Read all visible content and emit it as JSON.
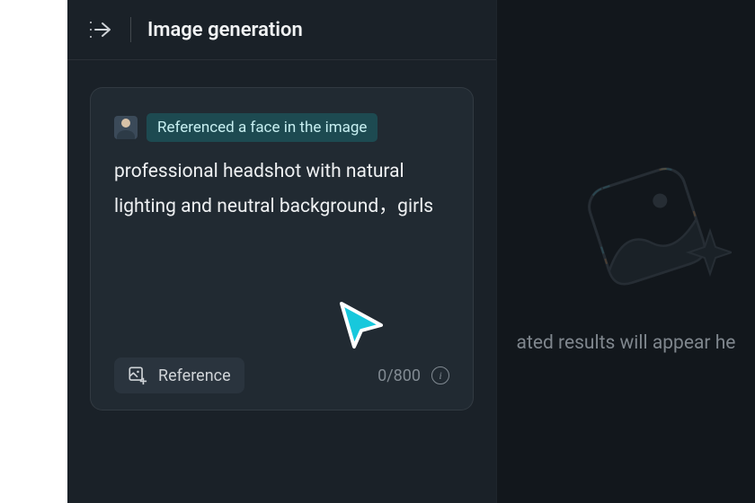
{
  "header": {
    "title": "Image generation"
  },
  "prompt_card": {
    "reference_badge": "Referenced a face in the image",
    "prompt_text": "professional headshot with natural lighting and neutral background，girls",
    "reference_button_label": "Reference",
    "char_counter": "0/800"
  },
  "empty_state": {
    "text": "ated results will appear he"
  },
  "icons": {
    "collapse": "collapse-panel-icon",
    "reference_add": "image-add-icon",
    "info": "info-icon",
    "placeholder": "image-sparkle-icon",
    "cursor": "cursor-icon"
  }
}
